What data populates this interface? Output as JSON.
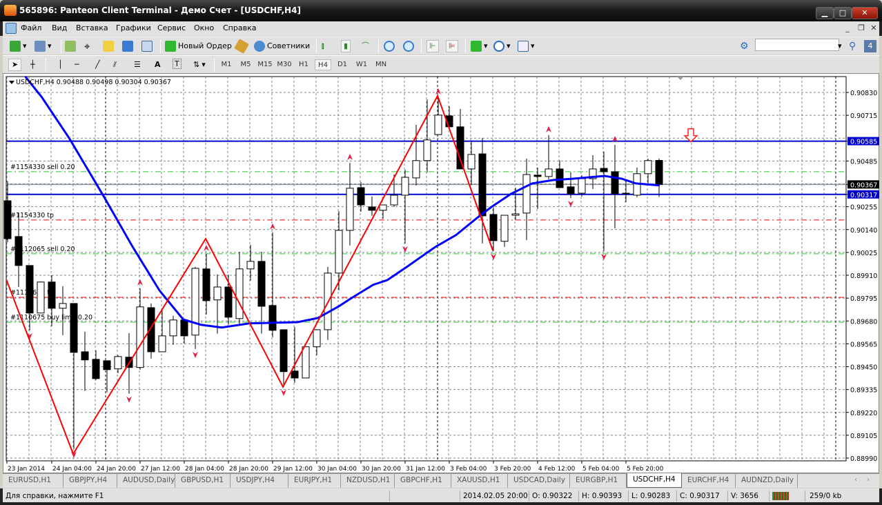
{
  "window": {
    "title": "565896: Panteon Client Terminal - Демо Счет - [USDCHF,H4]",
    "minimize": "▁",
    "maximize": "□",
    "close": "✕"
  },
  "menu": {
    "items": [
      "Файл",
      "Вид",
      "Вставка",
      "Графики",
      "Сервис",
      "Окно",
      "Справка"
    ],
    "mdi": [
      "_",
      "❐",
      "✕"
    ]
  },
  "toolbar": {
    "new_order": "Новый Ордер",
    "advisors": "Советники",
    "search_placeholder": "",
    "notif_count": "4"
  },
  "timeframes": [
    "M1",
    "M5",
    "M15",
    "M30",
    "H1",
    "H4",
    "D1",
    "W1",
    "MN"
  ],
  "active_timeframe": "H4",
  "drawing_tools": {
    "text_label": "A",
    "text_box": "T"
  },
  "chart": {
    "header": "USDCHF,H4  0.90488 0.90498 0.90304 0.90367",
    "colors": {
      "ma": "#0000ff",
      "zigzag": "#ff0000",
      "bull": "#ffffff",
      "bear": "#000000",
      "buy_line": "#22cc22",
      "tp_line": "#ff0000",
      "level": "#0000cc",
      "arrow": "#dd2244"
    },
    "price_labels": [
      "0.90830",
      "0.90715",
      "0.90585",
      "0.90485",
      "0.90367",
      "0.90317",
      "0.90255",
      "0.90140",
      "0.90025",
      "0.89910",
      "0.89795",
      "0.89680",
      "0.89565",
      "0.89450",
      "0.89335",
      "0.89220",
      "0.89105",
      "0.88990"
    ],
    "price_grid": [
      0.9083,
      0.90715,
      0.906,
      0.90485,
      0.9037,
      0.90255,
      0.9014,
      0.90025,
      0.8991,
      0.89795,
      0.8968,
      0.89565,
      0.8945,
      0.89335,
      0.8922,
      0.89105,
      0.8899
    ],
    "time_labels": [
      "23 Jan 2014",
      "24 Jan 04:00",
      "24 Jan 20:00",
      "27 Jan 12:00",
      "28 Jan 04:00",
      "28 Jan 20:00",
      "29 Jan 12:00",
      "30 Jan 04:00",
      "30 Jan 20:00",
      "31 Jan 12:00",
      "3 Feb 04:00",
      "3 Feb 20:00",
      "4 Feb 12:00",
      "5 Feb 04:00",
      "5 Feb 20:00"
    ],
    "candles": [
      [
        0.90285,
        0.90382,
        0.90077,
        0.90094
      ],
      [
        0.90105,
        0.90226,
        0.89851,
        0.89959
      ],
      [
        0.89959,
        0.89959,
        0.89633,
        0.8972
      ],
      [
        0.8972,
        0.89879,
        0.8972,
        0.89876
      ],
      [
        0.89876,
        0.8991,
        0.89654,
        0.89744
      ],
      [
        0.89744,
        0.89855,
        0.89609,
        0.89768
      ],
      [
        0.89768,
        0.89768,
        0.89036,
        0.89522
      ],
      [
        0.89525,
        0.89626,
        0.89328,
        0.89484
      ],
      [
        0.89487,
        0.89532,
        0.89383,
        0.8939
      ],
      [
        0.8948,
        0.8948,
        0.89321,
        0.89435
      ],
      [
        0.89439,
        0.89508,
        0.89418,
        0.89501
      ],
      [
        0.89498,
        0.89619,
        0.89314,
        0.89446
      ],
      [
        0.89446,
        0.89845,
        0.89435,
        0.89751
      ],
      [
        0.89747,
        0.89768,
        0.89491,
        0.89525
      ],
      [
        0.89525,
        0.89737,
        0.89525,
        0.89605
      ],
      [
        0.89605,
        0.89706,
        0.8956,
        0.89685
      ],
      [
        0.89685,
        0.89685,
        0.89567,
        0.89605
      ],
      [
        0.89609,
        0.89952,
        0.89539,
        0.89945
      ],
      [
        0.89942,
        0.90018,
        0.89713,
        0.89782
      ],
      [
        0.89786,
        0.89914,
        0.89616,
        0.89851
      ],
      [
        0.89851,
        0.89914,
        0.89661,
        0.89699
      ],
      [
        0.89692,
        0.90028,
        0.89661,
        0.89942
      ],
      [
        0.89942,
        0.90063,
        0.89883,
        0.8998
      ],
      [
        0.8998,
        0.90028,
        0.89616,
        0.89754
      ],
      [
        0.89758,
        0.90126,
        0.89598,
        0.89633
      ],
      [
        0.89636,
        0.89636,
        0.89348,
        0.89425
      ],
      [
        0.89428,
        0.8965,
        0.89369,
        0.89393
      ],
      [
        0.89393,
        0.8955,
        0.89393,
        0.8955
      ],
      [
        0.8955,
        0.89636,
        0.89508,
        0.89636
      ],
      [
        0.89636,
        0.89952,
        0.89584,
        0.89921
      ],
      [
        0.89921,
        0.90233,
        0.89834,
        0.90136
      ],
      [
        0.90136,
        0.90476,
        0.9006,
        0.90348
      ],
      [
        0.90351,
        0.90379,
        0.9023,
        0.90264
      ],
      [
        0.90254,
        0.90306,
        0.90209,
        0.90237
      ],
      [
        0.90237,
        0.90264,
        0.90195,
        0.90264
      ],
      [
        0.90264,
        0.90417,
        0.90254,
        0.90313
      ],
      [
        0.90313,
        0.90441,
        0.9007,
        0.90403
      ],
      [
        0.904,
        0.90667,
        0.90362,
        0.90487
      ],
      [
        0.90487,
        0.90795,
        0.90428,
        0.90591
      ],
      [
        0.90618,
        0.90806,
        0.90618,
        0.90716
      ],
      [
        0.90712,
        0.90761,
        0.90657,
        0.90657
      ],
      [
        0.90657,
        0.90747,
        0.90445,
        0.90445
      ],
      [
        0.90445,
        0.90584,
        0.90365,
        0.90518
      ],
      [
        0.90521,
        0.90601,
        0.9007,
        0.90209
      ],
      [
        0.90216,
        0.90251,
        0.90032,
        0.90084
      ],
      [
        0.90081,
        0.90212,
        0.90053,
        0.90212
      ],
      [
        0.90212,
        0.90351,
        0.90188,
        0.90219
      ],
      [
        0.90223,
        0.90497,
        0.90087,
        0.90417
      ],
      [
        0.90414,
        0.90452,
        0.90244,
        0.90407
      ],
      [
        0.90407,
        0.90615,
        0.90393,
        0.90445
      ],
      [
        0.90445,
        0.90487,
        0.90351,
        0.90351
      ],
      [
        0.90355,
        0.90428,
        0.90299,
        0.9032
      ],
      [
        0.90323,
        0.90414,
        0.90306,
        0.90396
      ],
      [
        0.90396,
        0.90514,
        0.90344,
        0.90445
      ],
      [
        0.90448,
        0.90532,
        0.90032,
        0.90431
      ],
      [
        0.90431,
        0.90566,
        0.90146,
        0.9032
      ],
      [
        0.9032,
        0.90389,
        0.90278,
        0.90323
      ],
      [
        0.90313,
        0.90452,
        0.90303,
        0.90421
      ],
      [
        0.90421,
        0.90497,
        0.90372,
        0.90487
      ],
      [
        0.90488,
        0.90498,
        0.90304,
        0.90367
      ]
    ],
    "ma": [
      [
        1.6,
        0.9091
      ],
      [
        3.1,
        0.90806
      ],
      [
        5.6,
        0.90598
      ],
      [
        8.75,
        0.90303
      ],
      [
        11.25,
        0.9006
      ],
      [
        13.75,
        0.89834
      ],
      [
        15.9,
        0.89688
      ],
      [
        17.5,
        0.89661
      ],
      [
        19.4,
        0.89647
      ],
      [
        21.9,
        0.89668
      ],
      [
        26.25,
        0.89674
      ],
      [
        28.1,
        0.89695
      ],
      [
        30,
        0.89754
      ],
      [
        31.25,
        0.89799
      ],
      [
        33.1,
        0.89862
      ],
      [
        34.4,
        0.89886
      ],
      [
        36.25,
        0.89956
      ],
      [
        38.75,
        0.90053
      ],
      [
        40.6,
        0.90112
      ],
      [
        42.5,
        0.90198
      ],
      [
        43.75,
        0.90251
      ],
      [
        45.6,
        0.9032
      ],
      [
        47.5,
        0.90372
      ],
      [
        49.4,
        0.90389
      ],
      [
        51.25,
        0.90396
      ],
      [
        54.06,
        0.9041
      ],
      [
        55.6,
        0.90396
      ],
      [
        56.9,
        0.90372
      ],
      [
        59.06,
        0.90362
      ]
    ],
    "zigzag": [
      [
        -0.1,
        0.89886
      ],
      [
        5.94,
        0.89011
      ],
      [
        17.94,
        0.90094
      ],
      [
        24.94,
        0.89348
      ],
      [
        38.94,
        0.90813
      ],
      [
        43.94,
        0.90035
      ]
    ],
    "fractals_up": [
      12,
      18,
      24,
      31,
      39,
      49,
      55
    ],
    "fractals_down": [
      2,
      6,
      11,
      17,
      25,
      36,
      44,
      51,
      54
    ],
    "levels": [
      {
        "price": 0.90585,
        "label": "0.90585"
      },
      {
        "price": 0.90317,
        "label": "0.90317"
      }
    ],
    "bid": {
      "price": 0.90367,
      "label": "0.90367"
    },
    "orders": [
      {
        "price": 0.90431,
        "type": "buy",
        "label": "#1154330 sell 0.20"
      },
      {
        "price": 0.90188,
        "type": "tp",
        "label": "#1154330 tp"
      },
      {
        "price": 0.90018,
        "type": "buy",
        "label": "#1112065 sell 0.20"
      },
      {
        "price": 0.89799,
        "type": "tp",
        "label": "#1110675 tp"
      },
      {
        "price": 0.89674,
        "type": "buy",
        "label": "#1110675 buy limit 0.20"
      }
    ],
    "sell_arrow_price": 0.90585
  },
  "tabs": {
    "items": [
      "EURUSD,H1",
      "GBPJPY,H4",
      "AUDUSD,Daily",
      "GBPUSD,H1",
      "USDJPY,H4",
      "EURJPY,H1",
      "NZDUSD,H1",
      "GBPCHF,H1",
      "XAUUSD,H1",
      "USDCAD,Daily",
      "EURGBP,H1",
      "USDCHF,H4",
      "EURCHF,H4",
      "AUDNZD,Daily"
    ],
    "active": "USDCHF,H4"
  },
  "status": {
    "help": "Для справки, нажмите F1",
    "datetime": "2014.02.05 20:00",
    "open": "O: 0.90322",
    "high": "H: 0.90393",
    "low": "L: 0.90283",
    "close": "C: 0.90317",
    "volume": "V: 3656",
    "traffic": "259/0 kb"
  }
}
